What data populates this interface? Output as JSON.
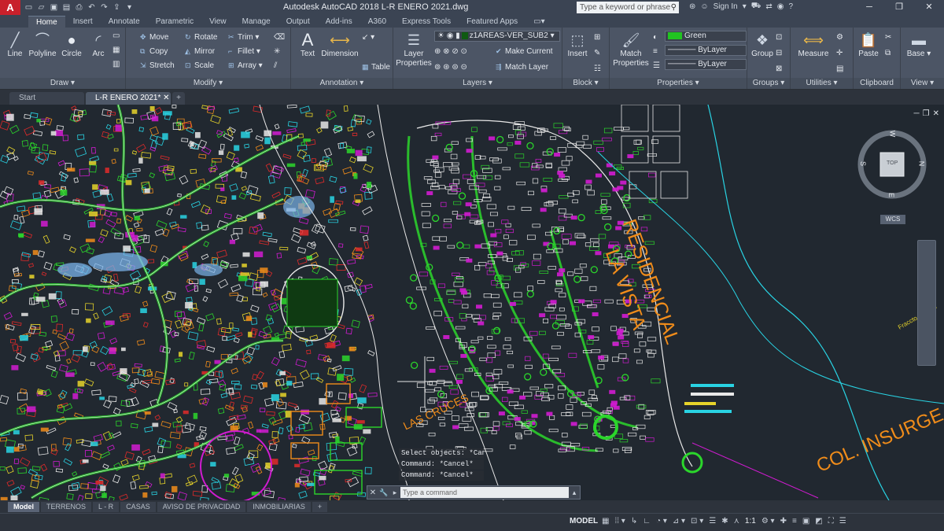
{
  "window": {
    "title": "Autodesk AutoCAD 2018   L-R ENERO 2021.dwg",
    "logo_letter": "A",
    "search_placeholder": "Type a keyword or phrase",
    "sign_in": "Sign In"
  },
  "ribbon_tabs": [
    "Home",
    "Insert",
    "Annotate",
    "Parametric",
    "View",
    "Manage",
    "Output",
    "Add-ins",
    "A360",
    "Express Tools",
    "Featured Apps"
  ],
  "ribbon": {
    "draw": {
      "label": "Draw",
      "line": "Line",
      "polyline": "Polyline",
      "circle": "Circle",
      "arc": "Arc"
    },
    "modify": {
      "label": "Modify",
      "move": "Move",
      "rotate": "Rotate",
      "trim": "Trim",
      "copy": "Copy",
      "mirror": "Mirror",
      "fillet": "Fillet",
      "stretch": "Stretch",
      "scale": "Scale",
      "array": "Array"
    },
    "annotation": {
      "label": "Annotation",
      "text": "Text",
      "dimension": "Dimension",
      "table": "Table"
    },
    "layers": {
      "label": "Layers",
      "layer_properties": "Layer\nProperties",
      "current_layer": "z1AREAS-VER_SUB2",
      "make_current": "Make Current",
      "match_layer": "Match Layer"
    },
    "block": {
      "label": "Block",
      "insert": "Insert"
    },
    "properties": {
      "label": "Properties",
      "match_properties": "Match\nProperties",
      "color": "Green",
      "linetype": "ByLayer",
      "lineweight": "ByLayer"
    },
    "groups": {
      "label": "Groups",
      "group": "Group"
    },
    "utilities": {
      "label": "Utilities",
      "measure": "Measure"
    },
    "clipboard": {
      "label": "Clipboard",
      "paste": "Paste"
    },
    "view": {
      "label": "View",
      "base": "Base"
    }
  },
  "doc_tabs": [
    "Start",
    "L-R ENERO 2021*"
  ],
  "canvas": {
    "labels": {
      "residencial": "RESIDENCIAL",
      "la_vista": "LA VISTA",
      "las_cruces": "LAS CRUCES",
      "col_insurgentes": "COL. INSURGE",
      "small_right": "Fraccto. de dos"
    },
    "viewcube": {
      "top": "TOP",
      "n": "N",
      "s": "S",
      "e": "E",
      "w": "W",
      "wcs": "WCS"
    },
    "accent_colors": {
      "orange": "#f08c1a",
      "green": "#2bd62b",
      "magenta": "#d11bd1",
      "cyan": "#29d3e3",
      "white": "#e8e8e8",
      "yellow": "#e6d32a",
      "red": "#e12a2a",
      "blue": "#2a5de6"
    }
  },
  "command": {
    "history": [
      "Select objects: *Cancel*",
      "Command: *Cancel*",
      "Command: *Cancel*"
    ],
    "placeholder": "Type a command"
  },
  "layout_tabs": [
    "Model",
    "TERRENOS",
    "L - R",
    "CASAS",
    "AVISO DE PRIVACIDAD",
    "INMOBILIARIAS"
  ],
  "status": {
    "model": "MODEL",
    "scale": "1:1"
  }
}
